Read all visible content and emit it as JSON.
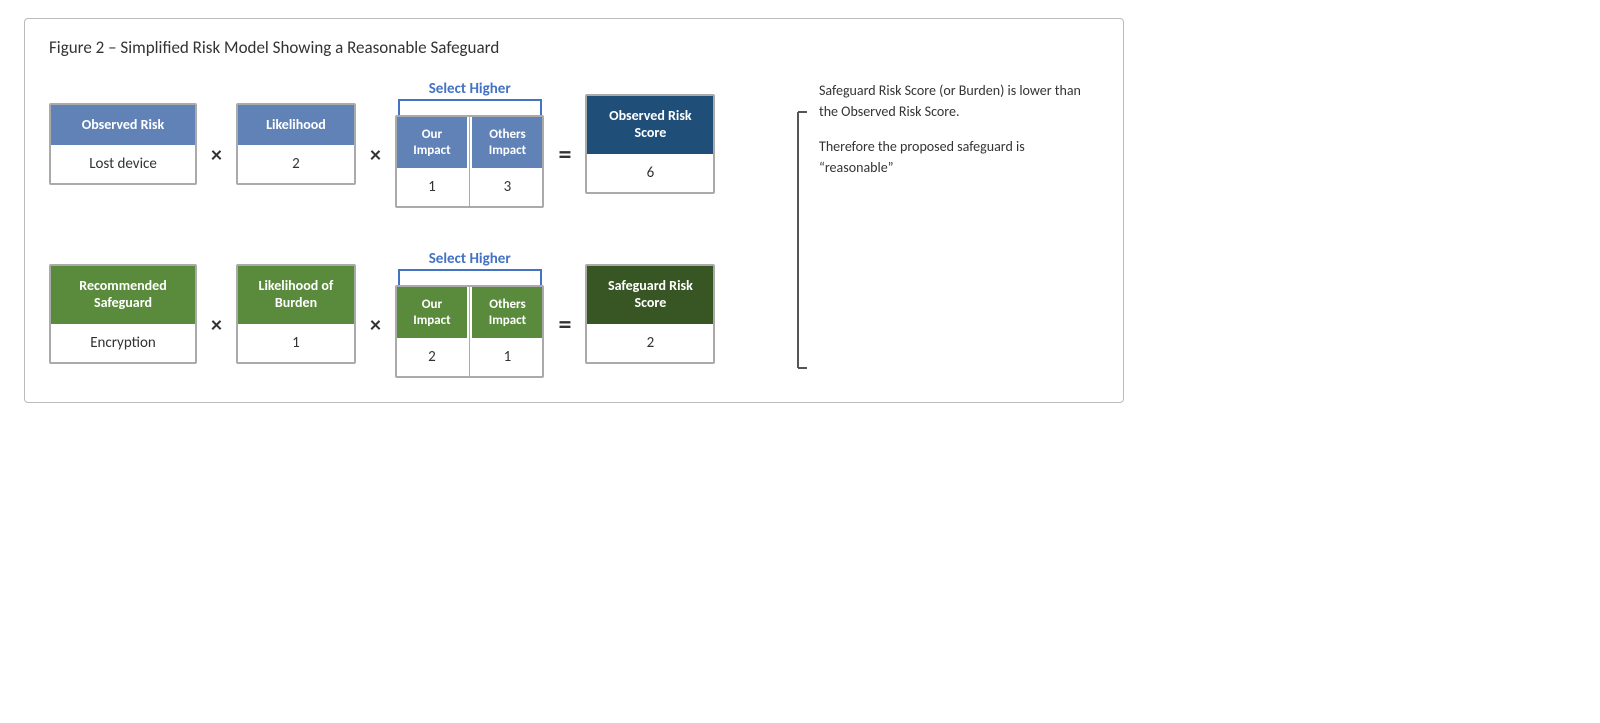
{
  "figure": {
    "title": "Figure 2 – Simplified Risk Model Showing a Reasonable Safeguard",
    "row1": {
      "select_higher": "Select Higher",
      "observed_risk": {
        "header": "Observed Risk",
        "value": "Lost device"
      },
      "likelihood": {
        "header": "Likelihood",
        "value": "2"
      },
      "our_impact": {
        "header": "Our Impact",
        "value": "1"
      },
      "others_impact": {
        "header": "Others Impact",
        "value": "3"
      },
      "operator": "X",
      "equals": "=",
      "result": {
        "header": "Observed Risk Score",
        "value": "6"
      }
    },
    "row2": {
      "select_higher": "Select Higher",
      "recommended_safeguard": {
        "header": "Recommended Safeguard",
        "value": "Encryption"
      },
      "likelihood": {
        "header": "Likelihood of Burden",
        "value": "1"
      },
      "our_impact": {
        "header": "Our Impact",
        "value": "2"
      },
      "others_impact": {
        "header": "Others Impact",
        "value": "1"
      },
      "operator": "X",
      "equals": "=",
      "result": {
        "header": "Safeguard Risk Score",
        "value": "2"
      }
    },
    "annotation": {
      "para1": "Safeguard Risk Score (or Burden) is lower than the Observed Risk Score.",
      "para2": "Therefore the proposed safeguard is “reasonable”"
    }
  }
}
